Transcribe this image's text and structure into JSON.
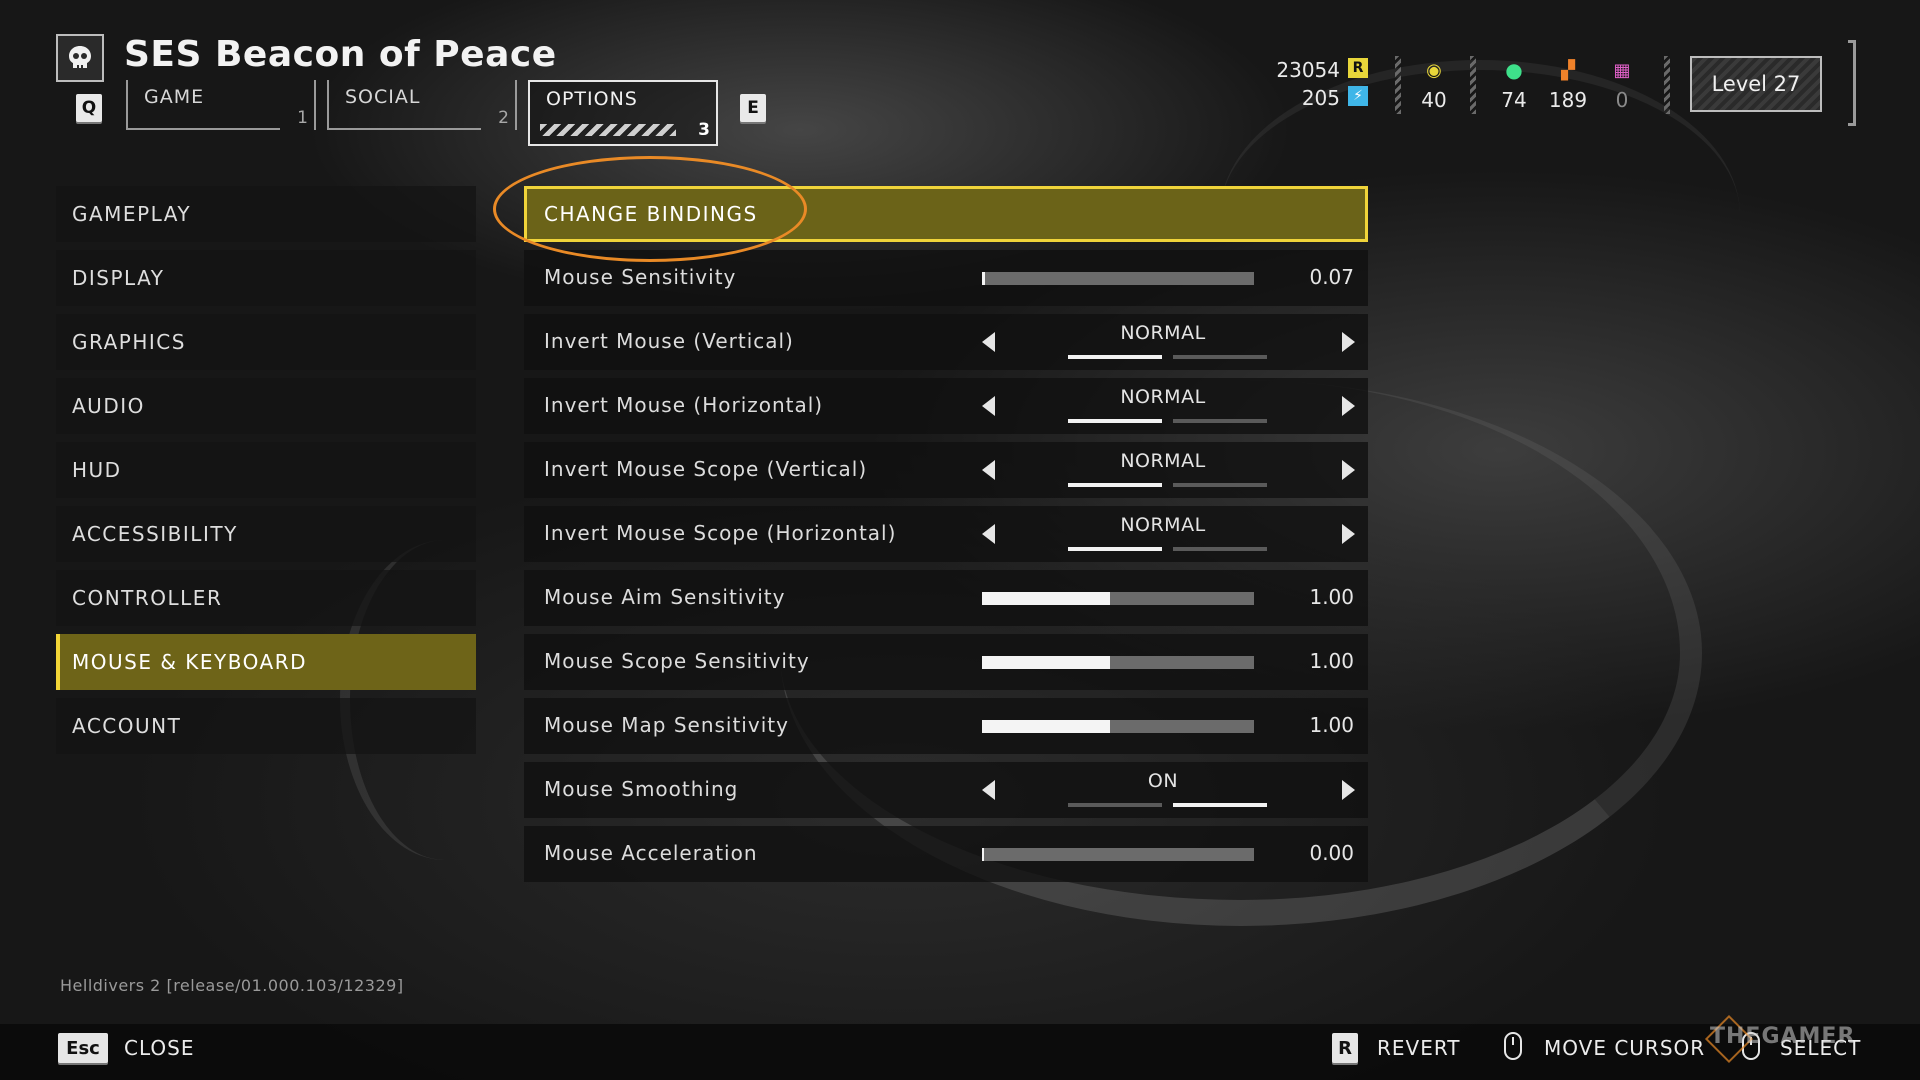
{
  "header": {
    "ship_name": "SES Beacon of Peace",
    "prev_key": "Q",
    "next_key": "E",
    "tabs": [
      {
        "label": "GAME",
        "number": "1"
      },
      {
        "label": "SOCIAL",
        "number": "2"
      },
      {
        "label": "OPTIONS",
        "number": "3"
      }
    ],
    "active_tab": "OPTIONS"
  },
  "resources": {
    "requisition": "23054",
    "requisition_badge": "R",
    "super_credits": "205",
    "medals": "40",
    "common_samples": "74",
    "rare_samples": "189",
    "super_samples": "0",
    "level": "Level 27",
    "colors": {
      "requisition": "#e8d63a",
      "super_credits": "#3fb6e8",
      "medals": "#e8d63a",
      "common_samples": "#3ee08a",
      "rare_samples": "#f0822a",
      "super_samples": "#e060c8"
    }
  },
  "menu": {
    "items": [
      "GAMEPLAY",
      "DISPLAY",
      "GRAPHICS",
      "AUDIO",
      "HUD",
      "ACCESSIBILITY",
      "CONTROLLER",
      "MOUSE & KEYBOARD",
      "ACCOUNT"
    ],
    "active": "MOUSE & KEYBOARD"
  },
  "settings": {
    "change_bindings": "CHANGE BINDINGS",
    "mouse_sensitivity": {
      "label": "Mouse Sensitivity",
      "value": "0.07",
      "fraction": 0.01
    },
    "invert_mouse_vertical": {
      "label": "Invert Mouse (Vertical)",
      "value": "NORMAL"
    },
    "invert_mouse_horizontal": {
      "label": "Invert Mouse (Horizontal)",
      "value": "NORMAL"
    },
    "invert_scope_vertical": {
      "label": "Invert Mouse Scope (Vertical)",
      "value": "NORMAL"
    },
    "invert_scope_horizontal": {
      "label": "Invert Mouse Scope (Horizontal)",
      "value": "NORMAL"
    },
    "aim_sensitivity": {
      "label": "Mouse Aim Sensitivity",
      "value": "1.00",
      "fraction": 0.47
    },
    "scope_sensitivity": {
      "label": "Mouse Scope Sensitivity",
      "value": "1.00",
      "fraction": 0.47
    },
    "map_sensitivity": {
      "label": "Mouse Map Sensitivity",
      "value": "1.00",
      "fraction": 0.47
    },
    "mouse_smoothing": {
      "label": "Mouse Smoothing",
      "value": "ON"
    },
    "mouse_acceleration": {
      "label": "Mouse Acceleration",
      "value": "0.00",
      "fraction": 0.0
    }
  },
  "version": "Helldivers 2 [release/01.000.103/12329]",
  "footer": {
    "close_key": "Esc",
    "close_label": "CLOSE",
    "revert_key": "R",
    "revert_label": "REVERT",
    "move_cursor_label": "MOVE CURSOR",
    "select_label": "SELECT"
  },
  "watermark": "THEGAMER"
}
